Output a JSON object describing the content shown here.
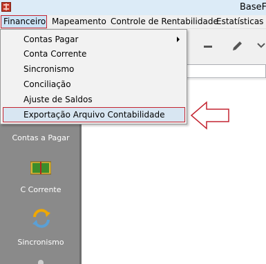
{
  "window": {
    "title": "BaseF"
  },
  "menubar": {
    "items": [
      {
        "label": "Financeiro"
      },
      {
        "label": "Mapeamento"
      },
      {
        "label": "Controle de Rentabilidade"
      },
      {
        "label": "Estatísticas"
      }
    ]
  },
  "dropdown": {
    "items": [
      {
        "label": "Contas Pagar",
        "has_submenu": true
      },
      {
        "label": "Conta Corrente"
      },
      {
        "label": "Sincronismo"
      },
      {
        "label": "Conciliação"
      },
      {
        "label": "Ajuste de Saldos"
      },
      {
        "label": "Exportação Arquivo Contabilidade",
        "highlighted": true
      }
    ]
  },
  "sidebar": {
    "items": [
      {
        "label": "Contas a  Pagar",
        "icon": "contas-pagar-icon"
      },
      {
        "label": "C Corrente",
        "icon": "book-icon"
      },
      {
        "label": "Sincronismo",
        "icon": "sync-icon"
      }
    ]
  },
  "toolbar": {
    "icons": [
      "minus-icon",
      "pencil-icon",
      "arrow-icon"
    ]
  },
  "colors": {
    "highlight_border": "#c42430",
    "menu_active_bg": "#cce4f7",
    "sidebar_bg": "#8a8a8a",
    "callout_stroke": "#c42430"
  }
}
